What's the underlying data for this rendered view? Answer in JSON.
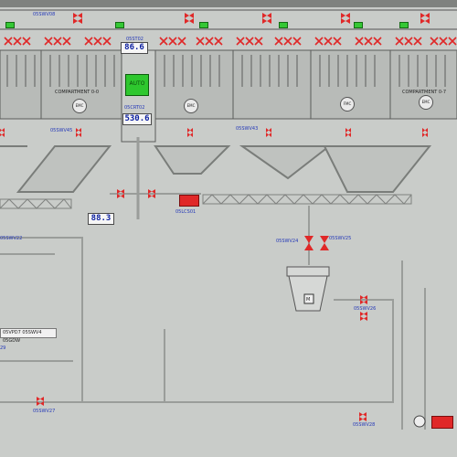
{
  "labels": {
    "top_valve": "05SWV08",
    "center_tag": "05ST02",
    "center_tag2": "05CRT02",
    "compartment_left": "COMPARTMENT 0-0",
    "compartment_right": "COMPARTMENT 0-7",
    "left_hopper_valve": "05SWV45",
    "right_hopper_valve": "05SWV43",
    "mid_valve": "05LCS01",
    "branch_valve": "05SWV22",
    "vessel_valve": "05SWV24",
    "pipe_valve_1": "05SWV26",
    "pipe_valve_2": "05SWV25",
    "bottom_valve": "05SWV27",
    "bottom_right_valve": "05SWV28",
    "left_info": "05VPD7 05SWV4 05GDW",
    "left_edge": "29",
    "motor_left": "EMC",
    "motor_center": "EMC",
    "motor_right": "FMC",
    "motor_far_right": "EMC",
    "vessel_label": "M"
  },
  "readings": {
    "top_value": "86.6",
    "mid_value": "530.6",
    "lower_value": "88.3"
  },
  "status": {
    "mode": "AUTO"
  },
  "colors": {
    "valve_red": "#e02828",
    "indicator_green": "#35c735",
    "pipe_gray": "#9a9d9a",
    "tag_blue": "#2438b8"
  }
}
